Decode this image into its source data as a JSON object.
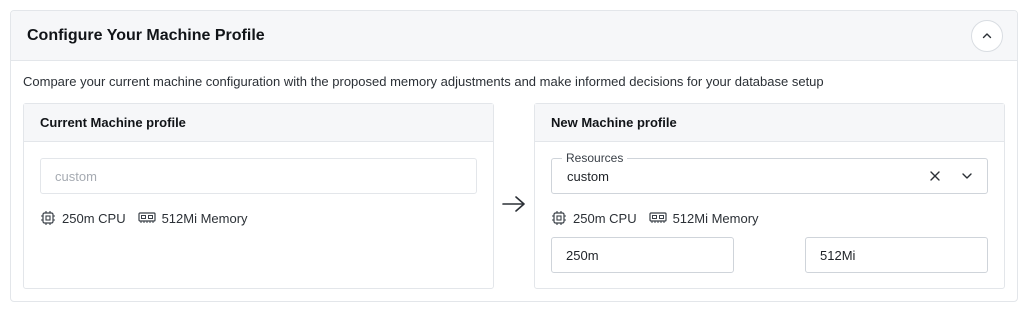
{
  "panel": {
    "title": "Configure Your Machine Profile",
    "collapse_icon": "chevron-up-icon",
    "description": "Compare your current machine configuration with the proposed memory adjustments and make informed decisions for your database setup"
  },
  "current_profile": {
    "title": "Current Machine profile",
    "profile_placeholder": "custom",
    "cpu": "250m CPU",
    "memory": "512Mi Memory"
  },
  "new_profile": {
    "title": "New Machine profile",
    "resources_label": "Resources",
    "resources_value": "custom",
    "cpu": "250m CPU",
    "memory": "512Mi Memory",
    "cpu_input_value": "250m",
    "memory_input_value": "512Mi"
  },
  "icons": {
    "arrow": "arrow-right-icon",
    "cpu": "cpu-chip-icon",
    "memory": "memory-module-icon",
    "clear": "close-icon",
    "dropdown": "chevron-down-icon"
  }
}
